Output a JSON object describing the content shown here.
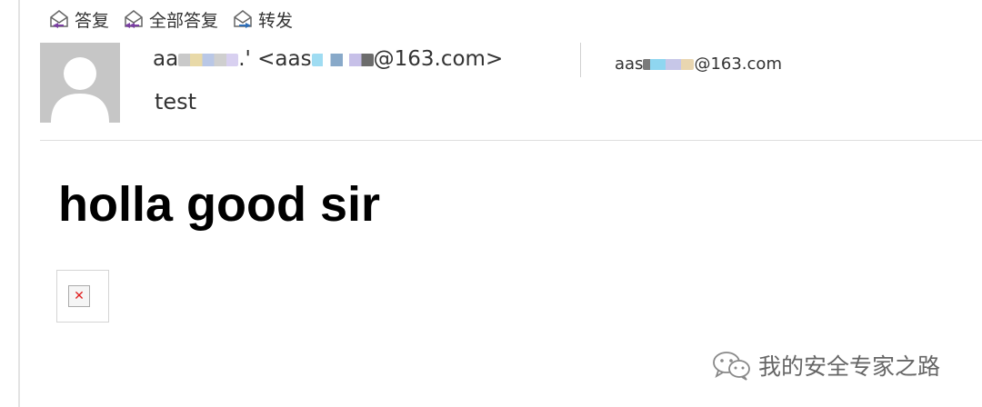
{
  "toolbar": {
    "reply_label": "答复",
    "reply_all_label": "全部答复",
    "forward_label": "转发"
  },
  "message": {
    "sender_name_visible": "aa",
    "sender_name_tail": ".'",
    "sender_email_prefix": "<aas",
    "sender_email_suffix": "@163.com>",
    "recipient_prefix": "aas",
    "recipient_suffix": "@163.com",
    "subject": "test"
  },
  "body": {
    "heading": "holla good sir",
    "broken_image_glyph": "✕"
  },
  "watermark": {
    "text": "我的安全专家之路"
  },
  "icons": {
    "reply": "envelope-reply-icon",
    "reply_all": "envelope-reply-all-icon",
    "forward": "envelope-forward-icon",
    "avatar": "default-user-avatar",
    "watermark": "wechat-icon"
  },
  "colors": {
    "reply_arrow": "#7b3fa3",
    "forward_arrow": "#2f6fb8",
    "avatar_bg": "#c6c6c6",
    "broken_image_x": "#e02020"
  }
}
